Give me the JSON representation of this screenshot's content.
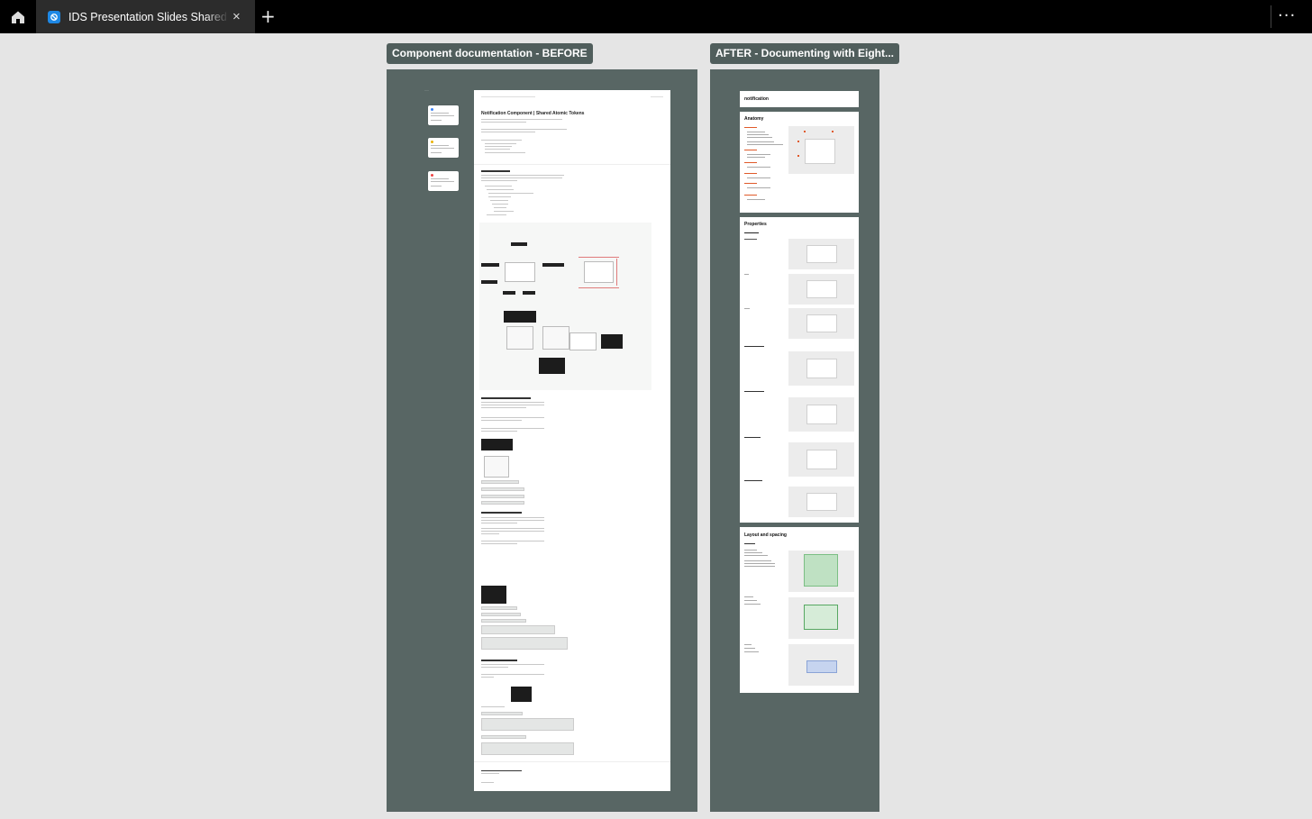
{
  "topbar": {
    "home_icon": "home-icon",
    "tab_title": "IDS Presentation Slides Shared - Ju",
    "tab_icon": "figjam-file-icon",
    "tab_close": "×",
    "add_tab": "+",
    "more_menu": "···"
  },
  "canvas": {
    "before_label": "Component documentation - BEFORE",
    "after_label": "AFTER - Documenting with Eight..."
  },
  "before_doc": {
    "title": "Notification Component | Shared Atomic Tokens"
  },
  "after_panels": {
    "header": "notification",
    "anatomy": "Anatomy",
    "properties": "Properties",
    "layout": "Layout and spacing"
  },
  "colors": {
    "topbar": "#000000",
    "tab_active": "#2c2c2c",
    "canvas": "#e5e5e5",
    "frame": "#586664",
    "label_bg": "#505e5c"
  }
}
